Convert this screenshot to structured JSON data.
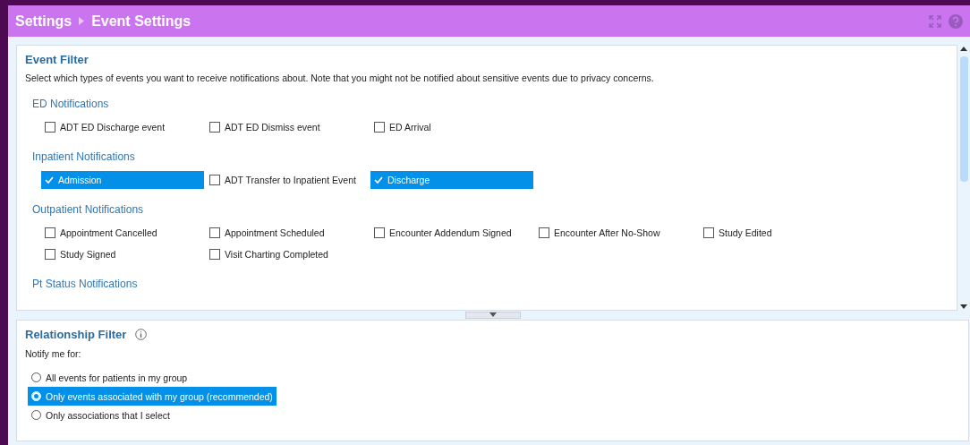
{
  "header": {
    "breadcrumb": [
      "Settings",
      "Event Settings"
    ]
  },
  "event_filter": {
    "title": "Event Filter",
    "description": "Select which types of events you want to receive notifications about. Note that you might not be notified about sensitive events due to privacy concerns.",
    "groups": [
      {
        "title": "ED Notifications",
        "items": [
          {
            "label": "ADT ED Discharge event",
            "checked": false
          },
          {
            "label": "ADT ED Dismiss event",
            "checked": false
          },
          {
            "label": "ED Arrival",
            "checked": false
          }
        ]
      },
      {
        "title": "Inpatient Notifications",
        "items": [
          {
            "label": "Admission",
            "checked": true
          },
          {
            "label": "ADT Transfer to Inpatient Event",
            "checked": false
          },
          {
            "label": "Discharge",
            "checked": true
          }
        ]
      },
      {
        "title": "Outpatient Notifications",
        "items": [
          {
            "label": "Appointment Cancelled",
            "checked": false
          },
          {
            "label": "Appointment Scheduled",
            "checked": false
          },
          {
            "label": "Encounter Addendum Signed",
            "checked": false
          },
          {
            "label": "Encounter After No-Show",
            "checked": false
          },
          {
            "label": "Study Edited",
            "checked": false
          },
          {
            "label": "Study Signed",
            "checked": false
          },
          {
            "label": "Visit Charting Completed",
            "checked": false
          }
        ]
      },
      {
        "title": "Pt Status Notifications"
      }
    ]
  },
  "relationship_filter": {
    "title": "Relationship Filter",
    "prompt": "Notify me for:",
    "options": [
      {
        "label": "All events for patients in my group",
        "selected": false
      },
      {
        "label": "Only events associated with my group (recommended)",
        "selected": true
      },
      {
        "label": "Only associations that I select",
        "selected": false
      }
    ]
  }
}
